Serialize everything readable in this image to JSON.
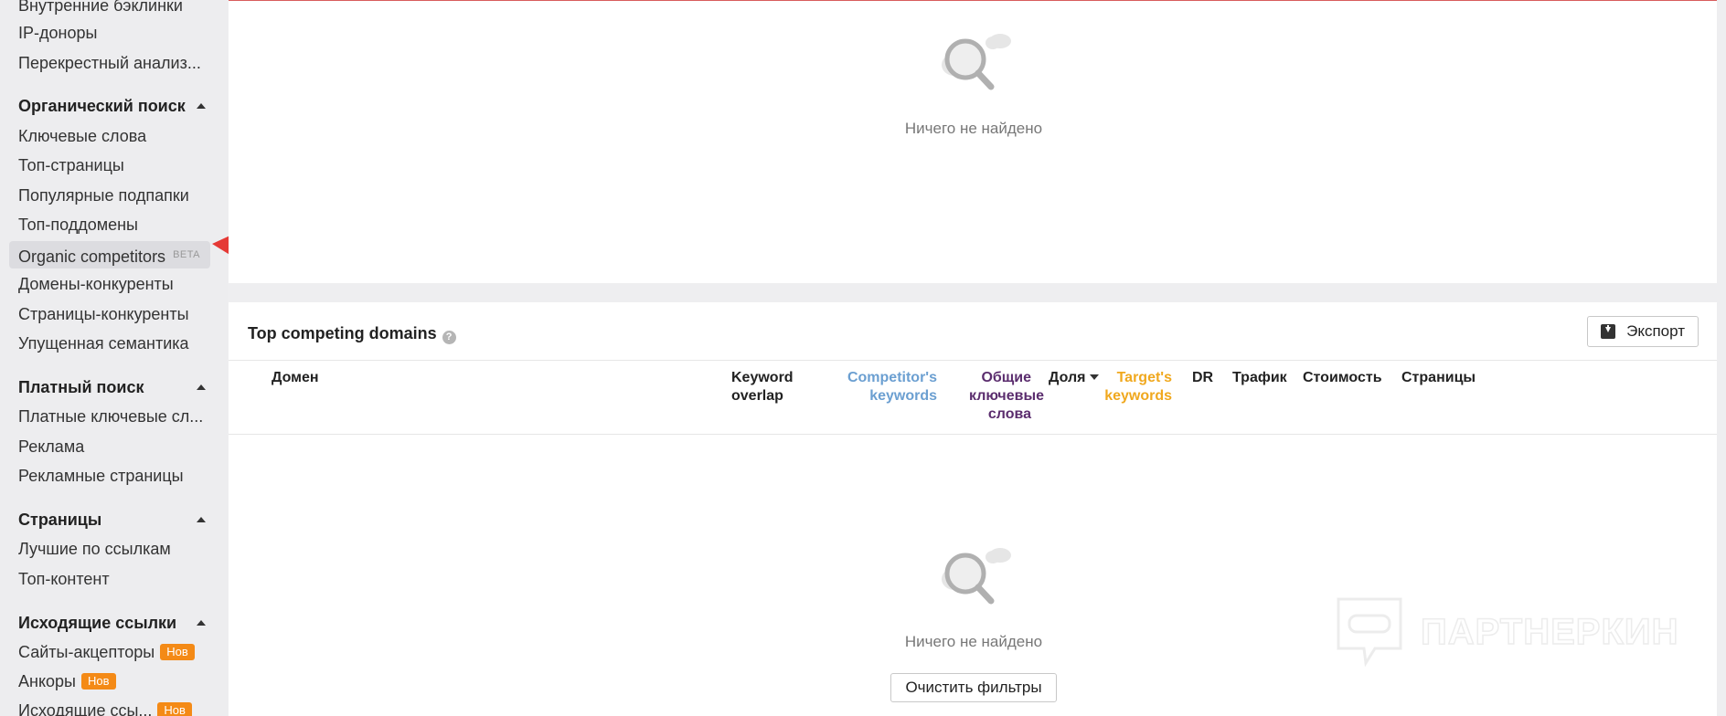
{
  "sidebar": {
    "top_items": [
      {
        "label": "Внутренние бэклинки"
      },
      {
        "label": "IP-доноры"
      },
      {
        "label": "Перекрестный анализ..."
      }
    ],
    "organic": {
      "title": "Органический поиск",
      "items": [
        {
          "label": "Ключевые слова"
        },
        {
          "label": "Топ-страницы"
        },
        {
          "label": "Популярные подпапки"
        },
        {
          "label": "Топ-поддомены"
        },
        {
          "label": "Organic competitors",
          "tag": "BETA"
        },
        {
          "label": "Домены-конкуренты"
        },
        {
          "label": "Страницы-конкуренты"
        },
        {
          "label": "Упущенная семантика"
        }
      ]
    },
    "paid": {
      "title": "Платный поиск",
      "items": [
        {
          "label": "Платные ключевые сл..."
        },
        {
          "label": "Реклама"
        },
        {
          "label": "Рекламные страницы"
        }
      ]
    },
    "pages": {
      "title": "Страницы",
      "items": [
        {
          "label": "Лучшие по ссылкам"
        },
        {
          "label": "Топ-контент"
        }
      ]
    },
    "outgoing": {
      "title": "Исходящие ссылки",
      "items": [
        {
          "label": "Сайты-акцепторы",
          "badge": "Нов"
        },
        {
          "label": "Анкоры",
          "badge": "Нов"
        },
        {
          "label": "Исходящие ссы...",
          "badge": "Нов"
        }
      ]
    }
  },
  "top_panel": {
    "empty_text": "Ничего не найдено"
  },
  "competing": {
    "title": "Top competing domains",
    "help": "?",
    "export_label": "Экспорт",
    "columns": {
      "domain": "Домен",
      "keyword_overlap": [
        "Keyword",
        "overlap"
      ],
      "competitor_keywords": [
        "Competitor's",
        "keywords"
      ],
      "common_keywords": [
        "Общие",
        "ключевые",
        "слова"
      ],
      "share": "Доля",
      "target_keywords": [
        "Target's",
        "keywords"
      ],
      "dr": "DR",
      "traffic": "Трафик",
      "cost": "Стоимость",
      "pages": "Страницы"
    },
    "empty_text": "Ничего не найдено",
    "clear_filters_label": "Очистить фильтры"
  },
  "watermark": {
    "text": "ПАРТНЕРКИН"
  },
  "colors": {
    "competitor_keywords": "#6b9fd1",
    "common_keywords": "#5b2d6e",
    "target_keywords": "#f0a81e",
    "badge": "#f48a16",
    "arrow": "#e53935"
  }
}
